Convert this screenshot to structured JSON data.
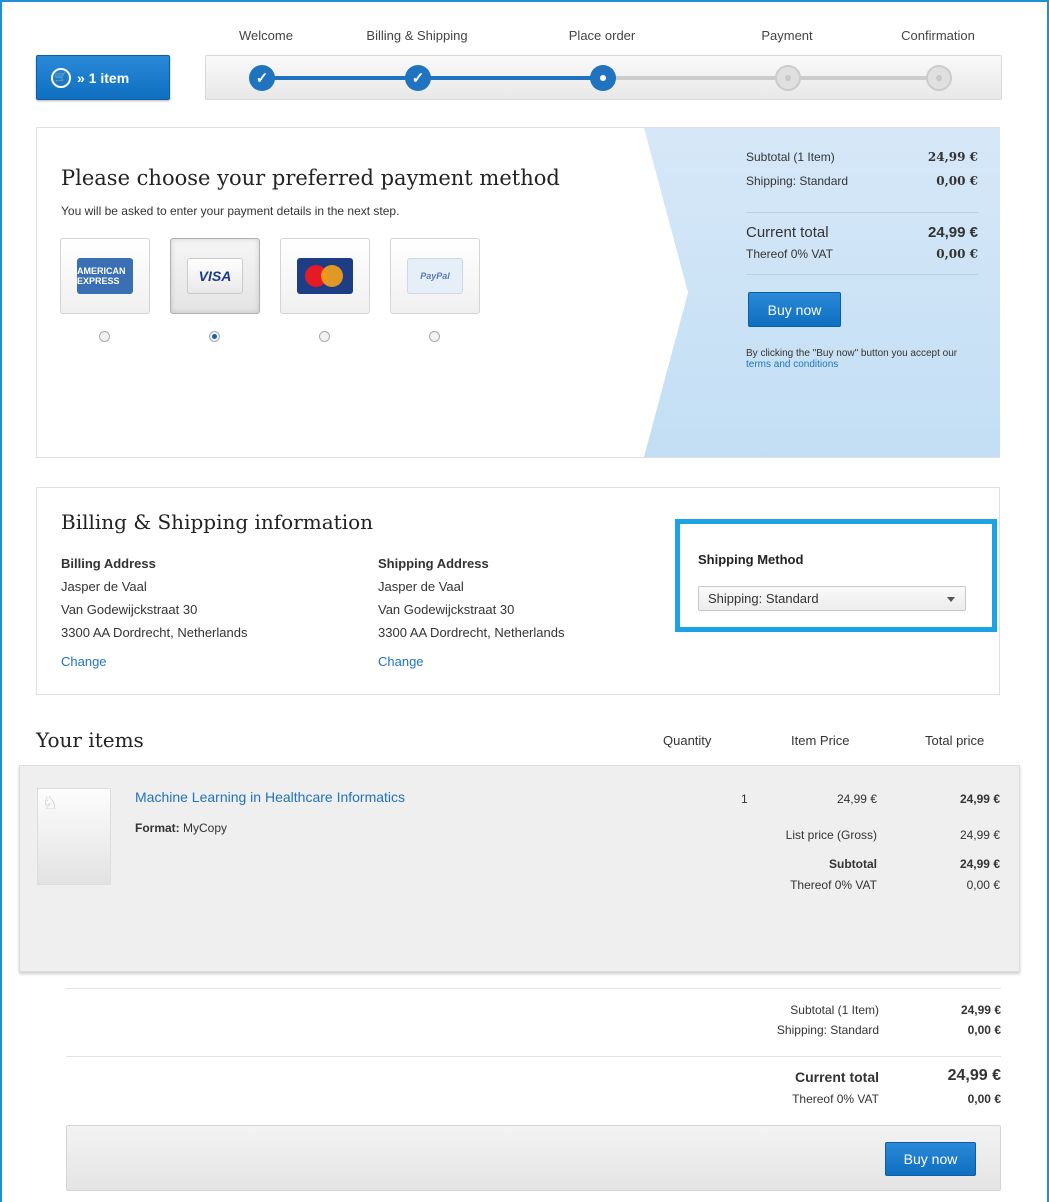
{
  "cart": {
    "label": "» 1 item"
  },
  "steps": [
    "Welcome",
    "Billing & Shipping",
    "Place order",
    "Payment",
    "Confirmation"
  ],
  "current_step": 3,
  "payment": {
    "title": "Please choose your preferred payment method",
    "subtitle": "You will be asked to enter your payment details in the next step.",
    "methods": [
      {
        "logo_text": "AMERICAN EXPRESS",
        "selected": false
      },
      {
        "logo_text": "VISA",
        "selected": true
      },
      {
        "logo_text": "MasterCard",
        "selected": false
      },
      {
        "logo_text": "PayPal",
        "selected": false
      }
    ]
  },
  "summary": {
    "subtotal_label": "Subtotal (1 Item)",
    "subtotal_value": "24,99 €",
    "shipping_label": "Shipping: Standard",
    "shipping_value": "0,00 €",
    "total_label": "Current total",
    "total_value": "24,99 €",
    "vat_label": "Thereof 0% VAT",
    "vat_value": "0,00 €",
    "buy_label": "Buy now",
    "terms_text": "By clicking the \"Buy now\" button you accept our",
    "terms_link": "terms and conditions"
  },
  "billing": {
    "title": "Billing & Shipping information",
    "billing_heading": "Billing Address",
    "shipping_heading": "Shipping Address",
    "name": "Jasper de Vaal",
    "street": "Van Godewijckstraat 30",
    "city": "3300 AA Dordrecht, Netherlands",
    "change_label": "Change",
    "method_heading": "Shipping Method",
    "method_value": "Shipping: Standard"
  },
  "items": {
    "title": "Your items",
    "col_quantity": "Quantity",
    "col_item_price": "Item Price",
    "col_total_price": "Total price",
    "row": {
      "name": "Machine Learning in Healthcare Informatics",
      "format_label": "Format:",
      "format_value": "MyCopy",
      "quantity": "1",
      "item_price": "24,99 €",
      "total_price": "24,99 €",
      "list_price_label": "List price (Gross)",
      "list_price_value": "24,99 €",
      "subtotal_label": "Subtotal",
      "subtotal_value": "24,99 €",
      "vat_label": "Thereof 0% VAT",
      "vat_value": "0,00 €"
    }
  },
  "totals": {
    "subtotal_label": "Subtotal (1 Item)",
    "subtotal_value": "24,99 €",
    "shipping_label": "Shipping: Standard",
    "shipping_value": "0,00 €",
    "total_label": "Current total",
    "total_value": "24,99 €",
    "vat_label": "Thereof 0% VAT",
    "vat_value": "0,00 €",
    "buy_label": "Buy now"
  },
  "colors": {
    "accent": "#1f73bf",
    "highlight_border": "#1ba3e4",
    "summary_bg": "#cfe4f7"
  }
}
